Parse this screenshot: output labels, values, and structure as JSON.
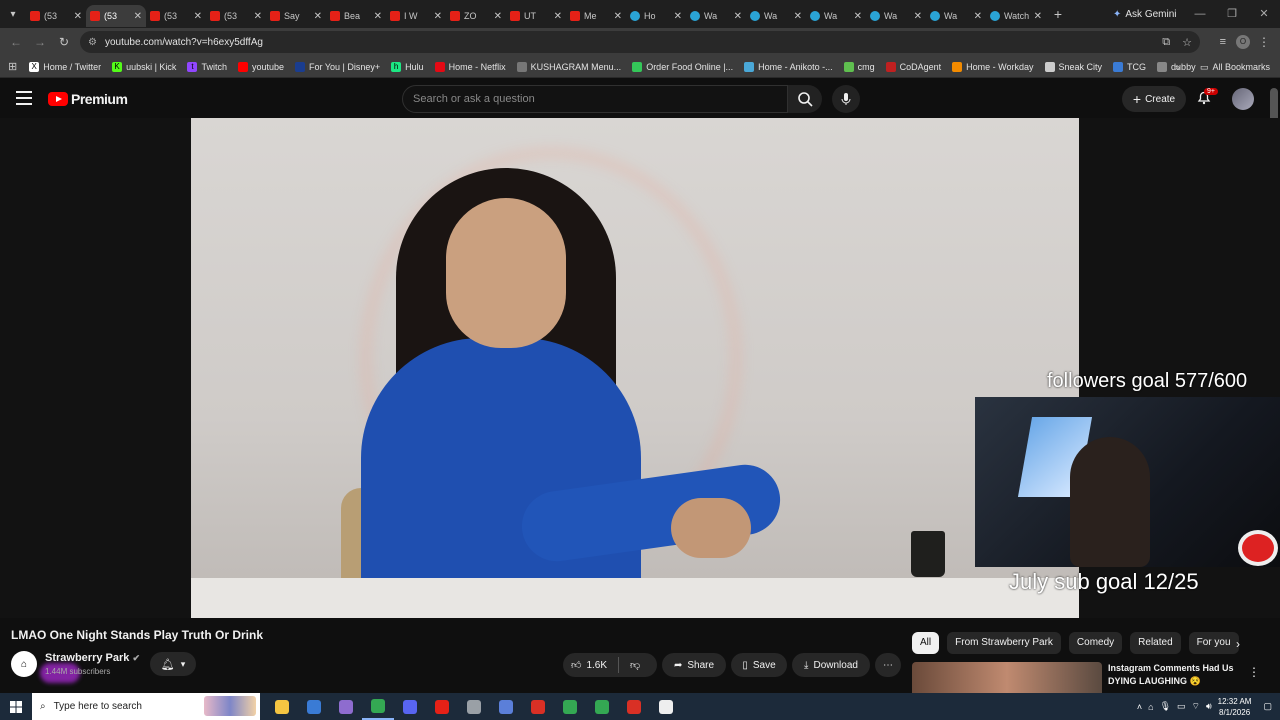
{
  "browser": {
    "tabs": [
      {
        "label": "(53",
        "kind": "yt",
        "active": false
      },
      {
        "label": "(53",
        "kind": "yt",
        "active": true
      },
      {
        "label": "(53",
        "kind": "yt",
        "active": false
      },
      {
        "label": "(53",
        "kind": "yt",
        "active": false
      },
      {
        "label": "Say",
        "kind": "yt",
        "active": false
      },
      {
        "label": "Bea",
        "kind": "yt",
        "active": false
      },
      {
        "label": "I W",
        "kind": "yt",
        "active": false
      },
      {
        "label": "ZO",
        "kind": "yt",
        "active": false
      },
      {
        "label": "UT",
        "kind": "yt",
        "active": false
      },
      {
        "label": "Me",
        "kind": "yt",
        "active": false
      },
      {
        "label": "Ho",
        "kind": "web",
        "active": false
      },
      {
        "label": "Wa",
        "kind": "web",
        "active": false
      },
      {
        "label": "Wa",
        "kind": "web",
        "active": false
      },
      {
        "label": "Wa",
        "kind": "web",
        "active": false
      },
      {
        "label": "Wa",
        "kind": "web",
        "active": false
      },
      {
        "label": "Wa",
        "kind": "web",
        "active": false
      },
      {
        "label": "Watch",
        "kind": "web",
        "active": false
      }
    ],
    "ask_gemini": "Ask Gemini",
    "url": "youtube.com/watch?v=h6exy5dffAg",
    "profile_initial": "O",
    "bookmarks": [
      {
        "label": "Home / Twitter",
        "icon": "X",
        "color": "#ffffff"
      },
      {
        "label": "uubski | Kick",
        "icon": "K",
        "color": "#53fc18"
      },
      {
        "label": "Twitch",
        "icon": "t",
        "color": "#9146ff"
      },
      {
        "label": "youtube",
        "icon": "",
        "color": "#ff0000"
      },
      {
        "label": "For You | Disney+",
        "icon": "",
        "color": "#1a3d8f"
      },
      {
        "label": "Hulu",
        "icon": "h",
        "color": "#1ce783"
      },
      {
        "label": "Home - Netflix",
        "icon": "",
        "color": "#e50914"
      },
      {
        "label": "KUSHAGRAM Menu...",
        "icon": "",
        "color": "#777777"
      },
      {
        "label": "Order Food Online |...",
        "icon": "",
        "color": "#34c759"
      },
      {
        "label": "Home - Anikoto -...",
        "icon": "",
        "color": "#4aa8d8"
      },
      {
        "label": "cmg",
        "icon": "",
        "color": "#5fbf4f"
      },
      {
        "label": "CoDAgent",
        "icon": "",
        "color": "#c02020"
      },
      {
        "label": "Home - Workday",
        "icon": "",
        "color": "#f38b00"
      },
      {
        "label": "Sneak City",
        "icon": "",
        "color": "#cccccc"
      },
      {
        "label": "TCG",
        "icon": "",
        "color": "#3a7bd5"
      },
      {
        "label": "dubby",
        "icon": "",
        "color": "#888888"
      }
    ],
    "all_bookmarks": "All Bookmarks"
  },
  "youtube": {
    "logo_text": "Premium",
    "search_placeholder": "Search or ask a question",
    "create_label": "Create",
    "notif_badge": "9+",
    "video": {
      "overlay_top": "followers goal 577/600",
      "overlay_bottom": "July sub goal 12/25"
    },
    "title": "LMAO One Night Stands Play Truth Or Drink",
    "channel": {
      "name": "Strawberry Park",
      "subscribers": "1.44M subscribers"
    },
    "actions": {
      "likes": "1.6K",
      "share": "Share",
      "save": "Save",
      "download": "Download"
    },
    "chips": [
      "All",
      "From Strawberry Park",
      "Comedy",
      "Related",
      "For you"
    ],
    "recommendation": {
      "title": "Instagram Comments Had Us DYING LAUGHING 😵"
    }
  },
  "taskbar": {
    "search_placeholder": "Type here to search",
    "apps": [
      {
        "color": "#f5c542",
        "active": false
      },
      {
        "color": "#3a7bd5",
        "active": false
      },
      {
        "color": "#8e6ccf",
        "active": false
      },
      {
        "color": "#34a853",
        "active": true
      },
      {
        "color": "#5865f2",
        "active": false
      },
      {
        "color": "#e62117",
        "active": false
      },
      {
        "color": "#9aa0a6",
        "active": false
      },
      {
        "color": "#5b7fd9",
        "active": false
      },
      {
        "color": "#d93025",
        "active": false
      },
      {
        "color": "#34a853",
        "active": false
      },
      {
        "color": "#34a853",
        "active": false
      },
      {
        "color": "#d93025",
        "active": false
      },
      {
        "color": "#eeeeee",
        "active": false
      }
    ],
    "time": "12:32 AM",
    "date": "8/1/2026"
  }
}
